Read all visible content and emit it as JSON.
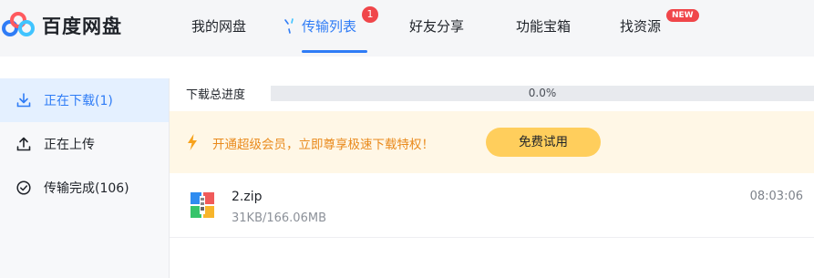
{
  "app": {
    "name": "百度网盘",
    "logo_icon": "baidu-netdisk-cloud-logo"
  },
  "nav": {
    "items": [
      {
        "label": "我的网盘"
      },
      {
        "label": "传输列表",
        "badge": "1",
        "active": true
      },
      {
        "label": "好友分享"
      },
      {
        "label": "功能宝箱"
      },
      {
        "label": "找资源",
        "badge": "NEW"
      }
    ]
  },
  "sidebar": {
    "items": [
      {
        "label": "正在下载(1)",
        "icon": "download-icon",
        "active": true
      },
      {
        "label": "正在上传",
        "icon": "upload-icon"
      },
      {
        "label": "传输完成(106)",
        "icon": "check-circle-icon"
      }
    ]
  },
  "progress": {
    "label": "下载总进度",
    "value_text": "0.0%",
    "value": 0.0
  },
  "promo": {
    "text": "开通超级会员，立即尊享极速下载特权！",
    "button": "免费试用",
    "icon": "lightning-bolt-icon"
  },
  "downloads": [
    {
      "name": "2.zip",
      "size": "31KB/166.06MB",
      "time": "08:03:06",
      "icon": "zip-archive-icon"
    }
  ],
  "colors": {
    "accent": "#2f7cf6",
    "badge": "#f0464a",
    "promo_text": "#e98a1c",
    "promo_button": "#ffce5c"
  }
}
